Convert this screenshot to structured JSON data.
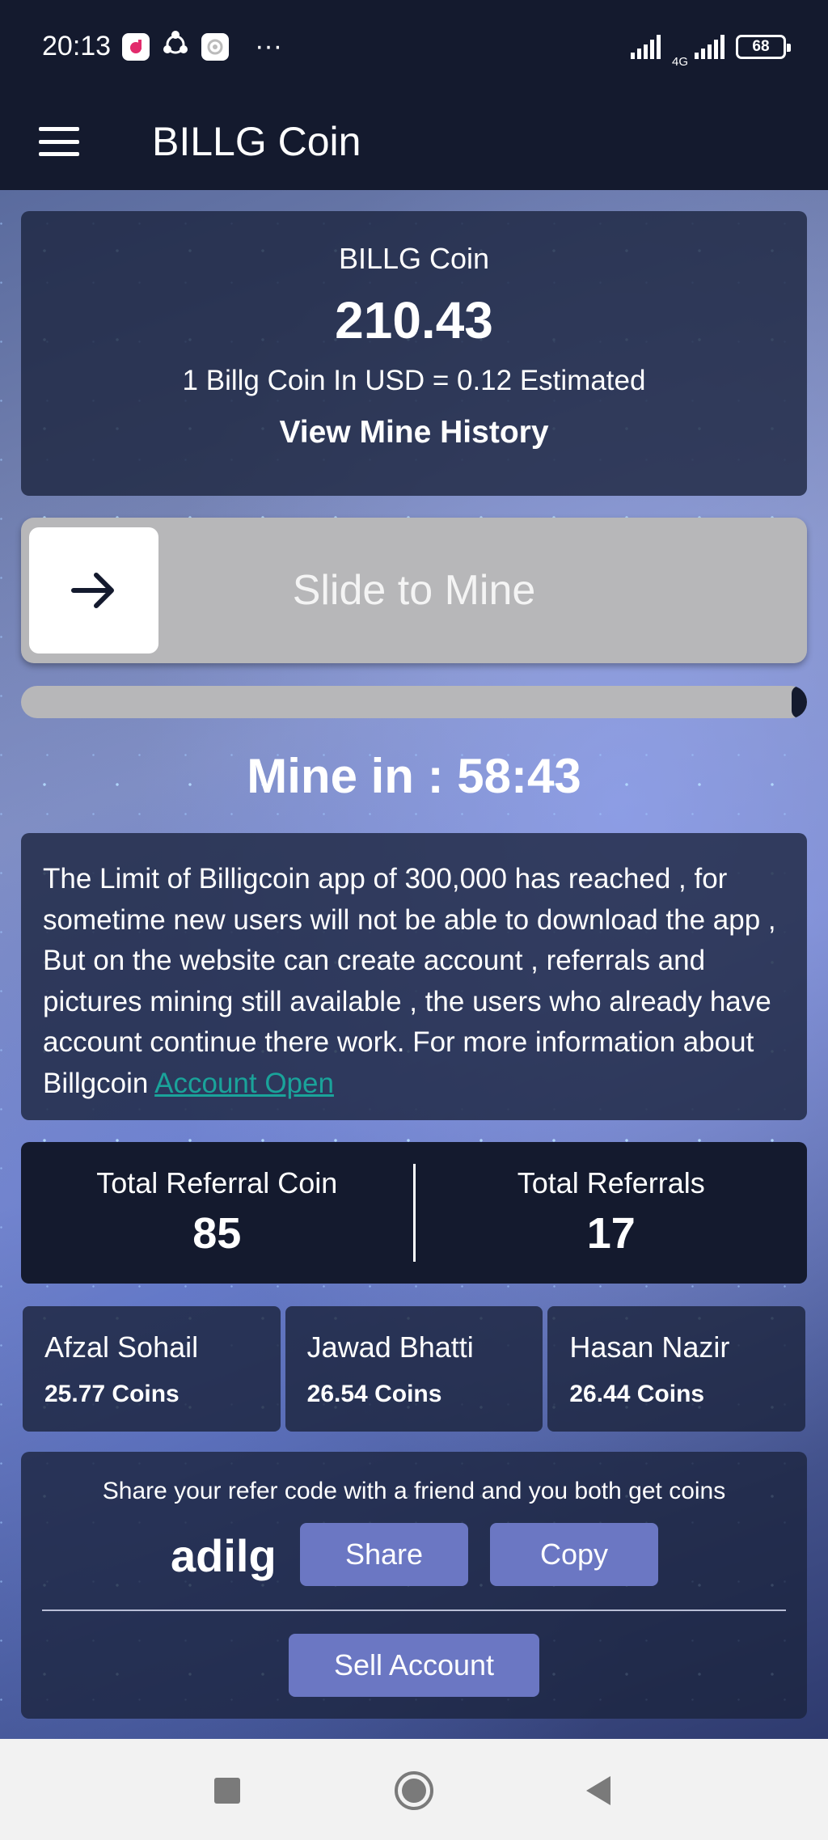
{
  "status_bar": {
    "time": "20:13",
    "more": "···",
    "network": "4G",
    "battery": "68"
  },
  "app_bar": {
    "title": "BILLG Coin"
  },
  "balance": {
    "label": "BILLG Coin",
    "amount": "210.43",
    "rate": "1 Billg Coin In USD = 0.12 Estimated",
    "history_link": "View Mine History"
  },
  "mine": {
    "slider_label": "Slide to Mine",
    "progress_remaining": 0.02,
    "timer": "Mine in : 58:43"
  },
  "notice": {
    "text": "The Limit of Billigcoin app of 300,000 has reached , for sometime new users will not be able to download the app , But on the website can create account , referrals and pictures mining still available , the users who already have account continue there work. For more information about Billgcoin ",
    "link": "Account Open"
  },
  "referrals": {
    "total_coin_label": "Total Referral Coin",
    "total_coin_value": "85",
    "total_count_label": "Total Referrals",
    "total_count_value": "17"
  },
  "users": [
    {
      "name": "Afzal Sohail",
      "coins": "25.77 Coins"
    },
    {
      "name": "Jawad Bhatti",
      "coins": "26.54 Coins"
    },
    {
      "name": "Hasan Nazir",
      "coins": "26.44 Coins"
    }
  ],
  "share": {
    "hint": "Share your refer code with a friend and you both get coins",
    "code": "adilg",
    "share_label": "Share",
    "copy_label": "Copy",
    "sell_label": "Sell Account"
  },
  "colors": {
    "app_bar": "#141a2e",
    "button": "#6b77c3",
    "link": "#1aa39a",
    "slider_track": "#b7b7b9"
  }
}
